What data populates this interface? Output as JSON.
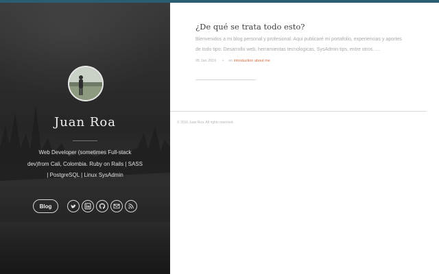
{
  "sidebar": {
    "author_name": "Juan Roa",
    "bio": "Web Developer (sometimes Full-stack dev)from Cali, Colombia. Ruby on Rails | SASS | PostgreSQL | Linux SysAdmin",
    "blog_button_label": "Blog",
    "social_icons": [
      "twitter-icon",
      "linkedin-icon",
      "github-icon",
      "email-icon",
      "rss-icon"
    ]
  },
  "post": {
    "title": "¿De qué se trata todo esto?",
    "excerpt": "Bienvenidos a mi blog personal y profesional. Aqui publicaré mi portafolio, experiencias y aportes de todo tipo: Desarrollo web, herramientas tecnologicas, SysAdmin tips, entre otros. …",
    "date": "05 Jan 2016",
    "separator": "•",
    "on_label": "on",
    "tags": "introduction about me"
  },
  "footer": {
    "copyright": "© 2016 Juan Roa. All rights reserved."
  },
  "colors": {
    "top_bar": "#2a5f72",
    "tag_link": "#d46a3e",
    "sidebar_bg": "#2e2e2e"
  }
}
